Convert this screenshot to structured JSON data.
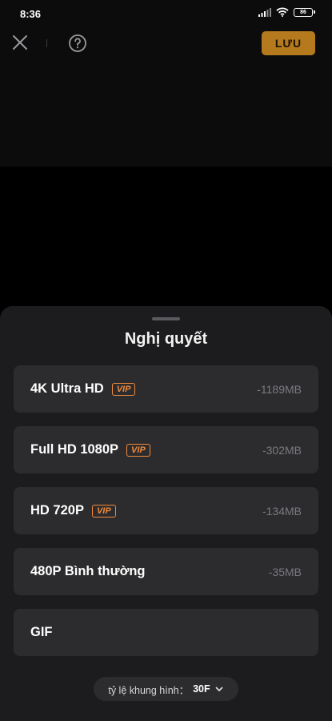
{
  "status_bar": {
    "time": "8:36",
    "battery_level": "86",
    "icons": [
      "signal-icon",
      "wifi-icon",
      "battery-icon"
    ]
  },
  "toolbar": {
    "save_label": "LƯU",
    "close_icon": "close-icon",
    "help_icon": "help-icon"
  },
  "colors": {
    "accent": "#b57a1d",
    "vip": "#f08a3b",
    "sheet_background": "#1c1c1e",
    "option_background": "#2c2c2e"
  },
  "resolution_sheet": {
    "title": "Nghị quyết",
    "options": [
      {
        "label": "4K Ultra HD",
        "vip": "VIP",
        "size": "-1189MB"
      },
      {
        "label": "Full HD 1080P",
        "vip": "VIP",
        "size": "-302MB"
      },
      {
        "label": "HD 720P",
        "vip": "VIP",
        "size": "-134MB"
      },
      {
        "label": "480P Bình thường",
        "size": "-35MB"
      },
      {
        "label": "GIF"
      }
    ],
    "frame_rate": {
      "label": "tỷ lệ khung hình：",
      "value": "30F",
      "icon": "chevron-down-icon"
    }
  }
}
